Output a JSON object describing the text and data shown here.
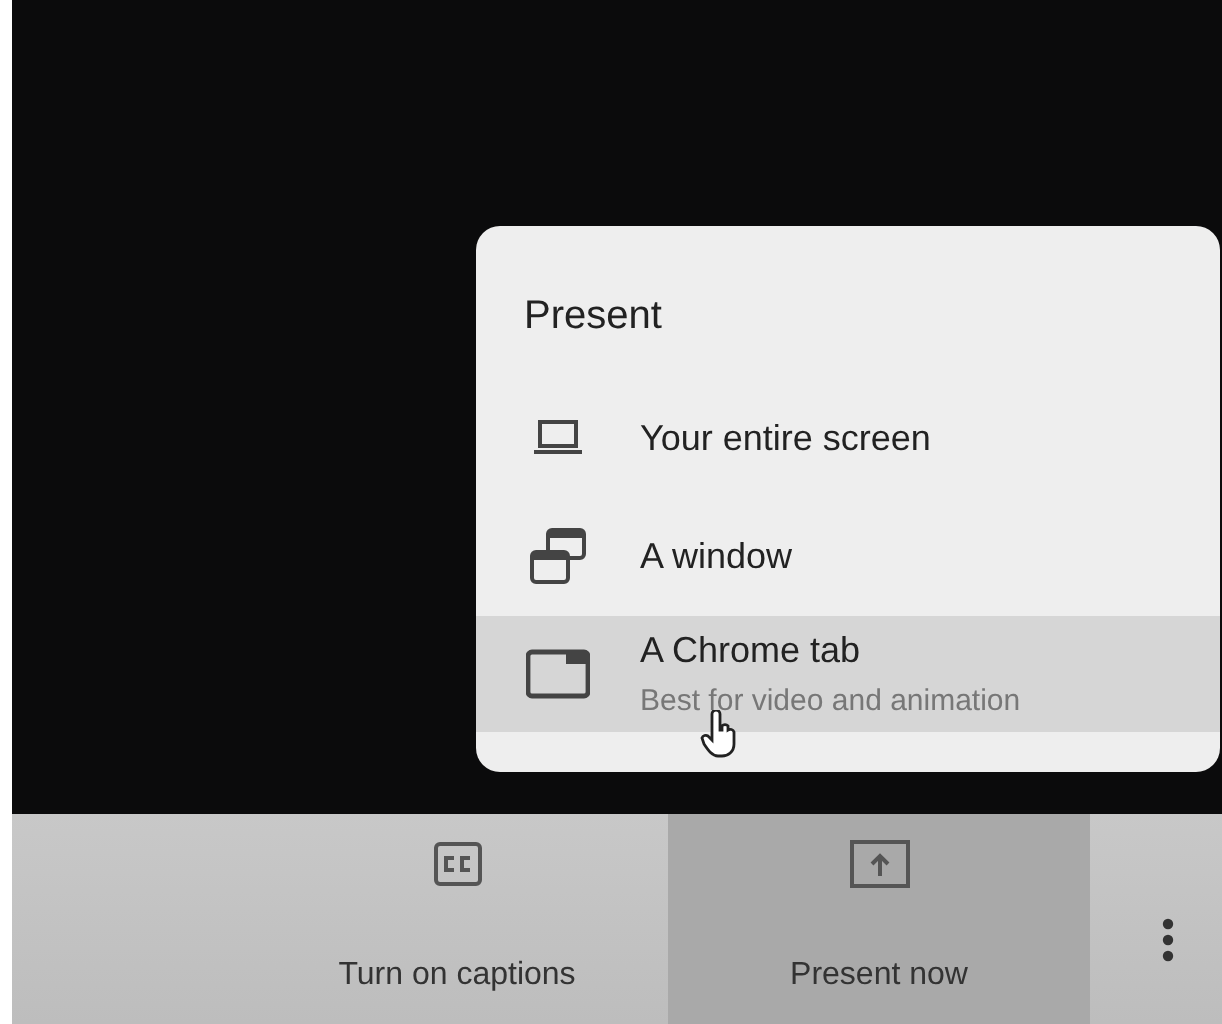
{
  "present_menu": {
    "title": "Present",
    "options": [
      {
        "label": "Your entire screen",
        "selected": false
      },
      {
        "label": "A window",
        "selected": false
      },
      {
        "label": "A Chrome tab",
        "description": "Best for video and animation",
        "selected": true
      }
    ]
  },
  "toolbar": {
    "buttons": [
      {
        "label": "Turn on captions",
        "selected": false
      },
      {
        "label": "Present now",
        "selected": true
      }
    ]
  }
}
